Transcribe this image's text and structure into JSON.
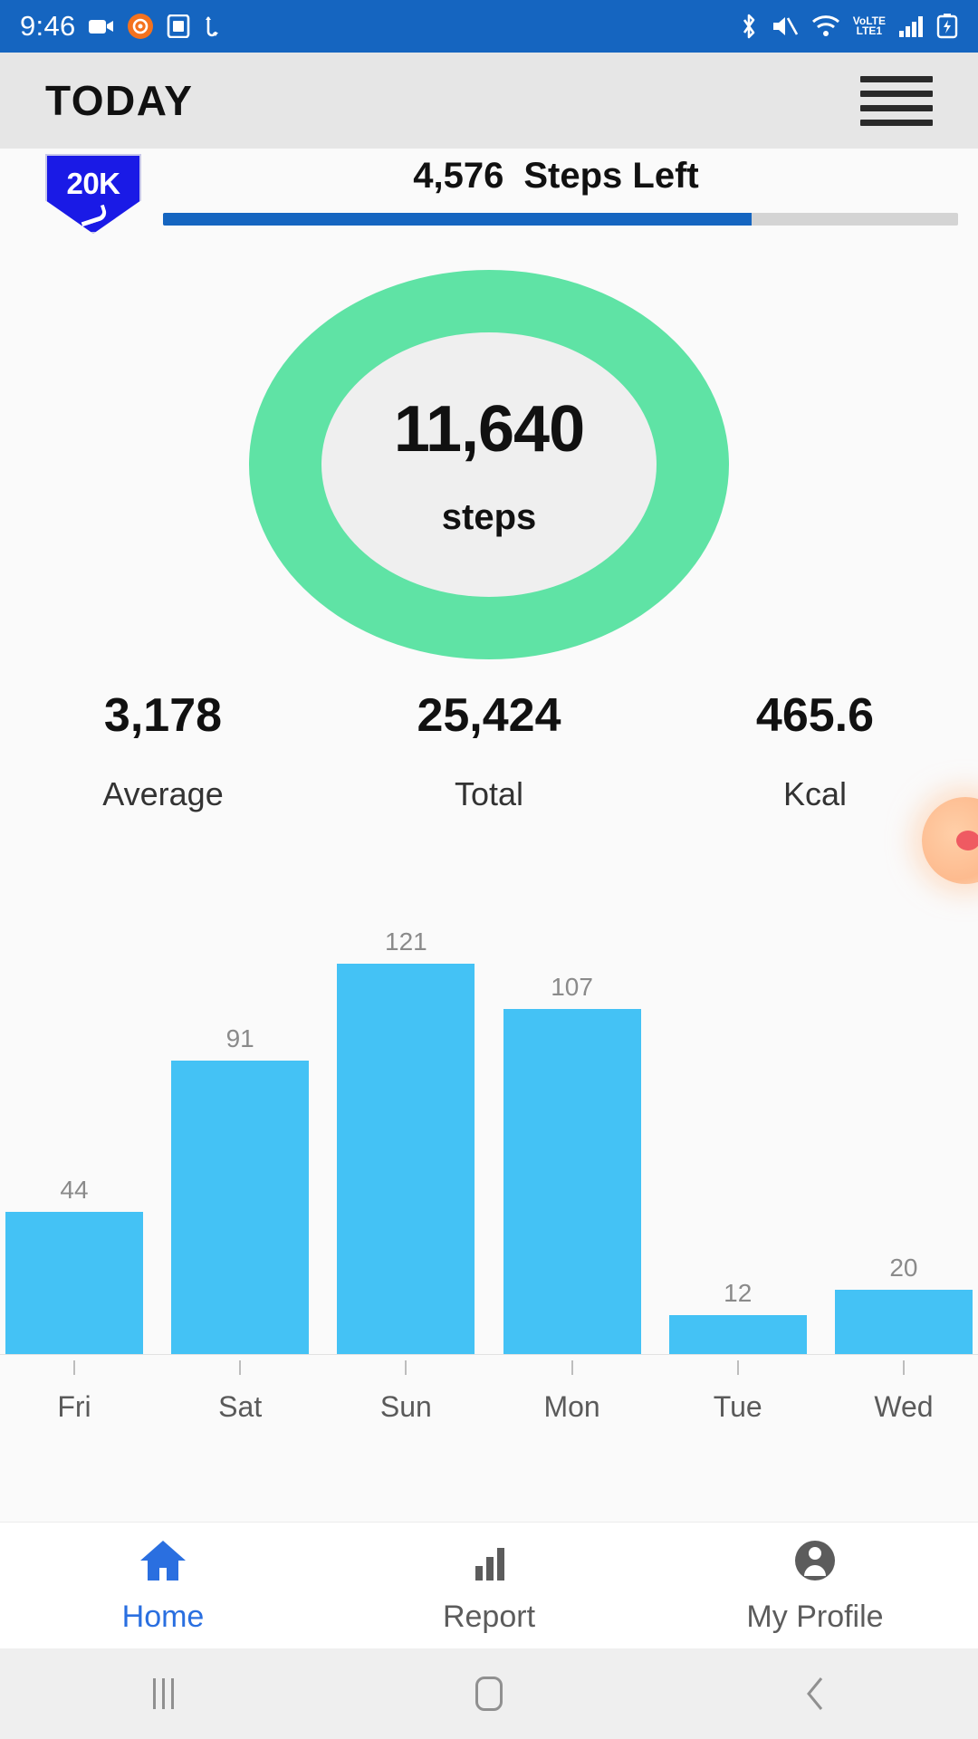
{
  "status_bar": {
    "time": "9:46",
    "left_icons": [
      "video-camera-icon",
      "record-circle-icon",
      "screen-cast-icon",
      "sync-arrows-icon"
    ],
    "right_icons": [
      "bluetooth-icon",
      "volume-mute-icon",
      "wifi-icon",
      "volte-icon",
      "signal-bars-icon",
      "battery-icon"
    ],
    "volte_top": "VoLTE",
    "volte_bottom": "LTE1",
    "background_color": "#1565c0"
  },
  "app_bar": {
    "title": "TODAY",
    "menu_icon": "hamburger-menu-icon"
  },
  "goal": {
    "badge_text": "20K",
    "steps_left_value": "4,576",
    "steps_left_label": "Steps Left",
    "progress_percent": 74,
    "progress_color": "#1565c0"
  },
  "ring": {
    "steps_value": "11,640",
    "steps_unit": "steps",
    "ring_color": "#5fe3a5",
    "inner_color": "#efefef"
  },
  "stats": [
    {
      "value": "3,178",
      "label": "Average"
    },
    {
      "value": "25,424",
      "label": "Total"
    },
    {
      "value": "465.6",
      "label": "Kcal"
    }
  ],
  "chart_data": {
    "type": "bar",
    "categories": [
      "Fri",
      "Sat",
      "Sun",
      "Mon",
      "Tue",
      "Wed"
    ],
    "values": [
      44,
      91,
      121,
      107,
      12,
      20
    ],
    "title": "",
    "xlabel": "",
    "ylabel": "",
    "ylim": [
      0,
      132
    ],
    "grid": false,
    "legend": "none",
    "bar_color": "#44c2f5",
    "value_label_color": "#8a8a8a"
  },
  "floating_bubble": {
    "icon": "floating-assistant-bubble-icon",
    "color": "#fdbb8f",
    "dot_color": "#ef5a62"
  },
  "bottom_nav": [
    {
      "label": "Home",
      "icon": "home-icon",
      "active": true
    },
    {
      "label": "Report",
      "icon": "bar-chart-icon",
      "active": false
    },
    {
      "label": "My Profile",
      "icon": "person-icon",
      "active": false
    }
  ],
  "android_nav": {
    "recents": "recent-apps-icon",
    "home": "android-home-icon",
    "back": "android-back-icon"
  }
}
